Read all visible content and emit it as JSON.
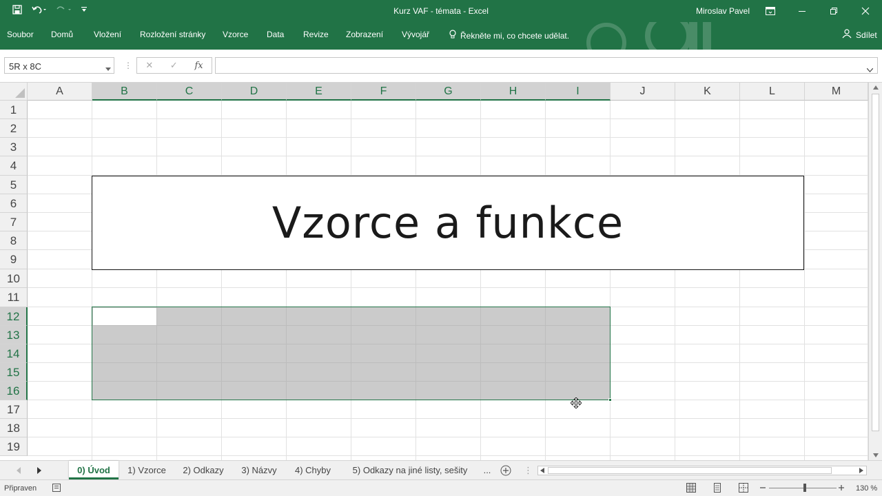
{
  "window": {
    "title": "Kurz VAF - témata  -  Excel",
    "user": "Miroslav Pavel"
  },
  "ribbon": {
    "tabs": [
      "Soubor",
      "Domů",
      "Vložení",
      "Rozložení stránky",
      "Vzorce",
      "Data",
      "Revize",
      "Zobrazení",
      "Vývojář"
    ],
    "tellme": "Řekněte mi, co chcete udělat.",
    "share": "Sdílet"
  },
  "formula_bar": {
    "name_box": "5R x 8C",
    "fx": "fx",
    "formula": ""
  },
  "grid": {
    "columns": [
      "A",
      "B",
      "C",
      "D",
      "E",
      "F",
      "G",
      "H",
      "I",
      "J",
      "K",
      "L",
      "M"
    ],
    "rows": [
      "1",
      "2",
      "3",
      "4",
      "5",
      "6",
      "7",
      "8",
      "9",
      "10",
      "11",
      "12",
      "13",
      "14",
      "15",
      "16",
      "17",
      "18",
      "19"
    ],
    "merged_title": "Vzorce a funkce",
    "selection": "B12:I16"
  },
  "sheets": {
    "tabs": [
      "0) Úvod",
      "1) Vzorce",
      "2) Odkazy",
      "3) Názvy",
      "4) Chyby",
      "5) Odkazy na jiné listy, sešity"
    ],
    "active": "0) Úvod",
    "more": "..."
  },
  "status": {
    "mode": "Připraven",
    "zoom": "130 %"
  },
  "colors": {
    "brand": "#217346"
  }
}
